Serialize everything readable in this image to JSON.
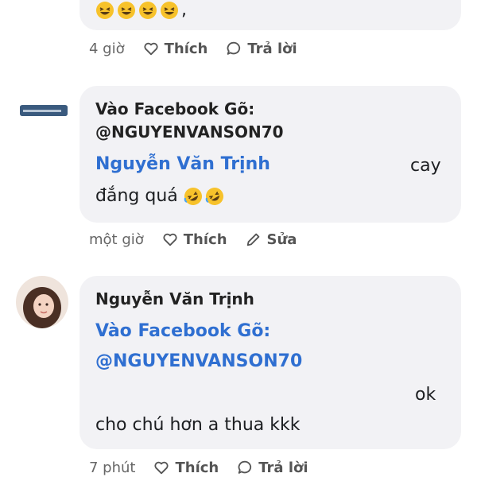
{
  "comment_0": {
    "trailing_text": ",",
    "emoji_icon": "grinning-squinting-face-icon",
    "time": "4 giờ",
    "like": "Thích",
    "reply": "Trả lời"
  },
  "comment_1": {
    "author": "Vào Facebook Gõ:",
    "author_line2": "@NGUYENVANSON70",
    "mention": "Nguyễn Văn Trịnh",
    "text_right": "cay",
    "text": "đắng quá",
    "emoji_icon": "rolling-on-floor-laughing-icon",
    "time": "một giờ",
    "like": "Thích",
    "edit": "Sửa"
  },
  "comment_2": {
    "author": "Nguyễn Văn Trịnh",
    "line1": "Vào Facebook Gõ:",
    "line2": "@NGUYENVANSON70",
    "text_right": "ok",
    "text": "cho chú hơn a thua kkk",
    "time": "7 phút",
    "like": "Thích",
    "reply": "Trả lời"
  },
  "colors": {
    "bubble": "#f2f2f5",
    "link": "#2f6fd1",
    "meta": "#5f6368"
  }
}
